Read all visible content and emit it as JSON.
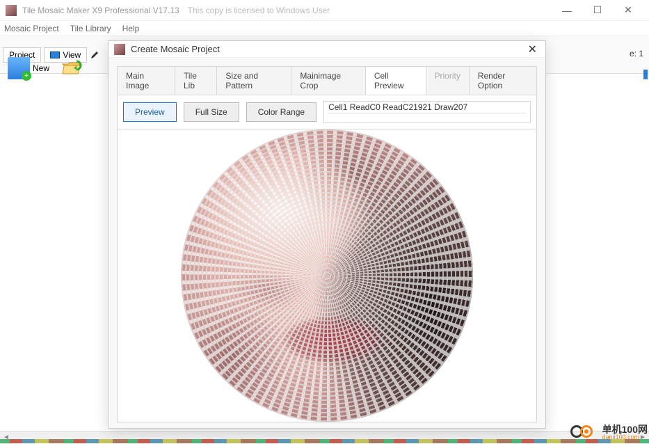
{
  "window": {
    "title": "Tile Mosaic Maker X9 Professional V17.13",
    "license": "This copy is licensed to Windows User"
  },
  "menu": {
    "project": "Mosaic Project",
    "library": "Tile Library",
    "help": "Help"
  },
  "toolbar": {
    "tab_project": "Project",
    "tab_view": "View",
    "new_label": "New",
    "status_right": "e: 1"
  },
  "dialog": {
    "title": "Create Mosaic Project",
    "tabs": {
      "main_image": "Main Image",
      "tile_lib": "Tile Lib",
      "size_pattern": "Size and Pattern",
      "crop": "Mainimage Crop",
      "cell_preview": "Cell Preview",
      "priority": "Priority",
      "render": "Render Option"
    },
    "buttons": {
      "preview": "Preview",
      "full_size": "Full Size",
      "color_range": "Color Range"
    },
    "status": "Cell1 ReadC0 ReadC21921  Draw207"
  },
  "watermark": {
    "cn": "单机100网",
    "en": "danji100.com"
  }
}
